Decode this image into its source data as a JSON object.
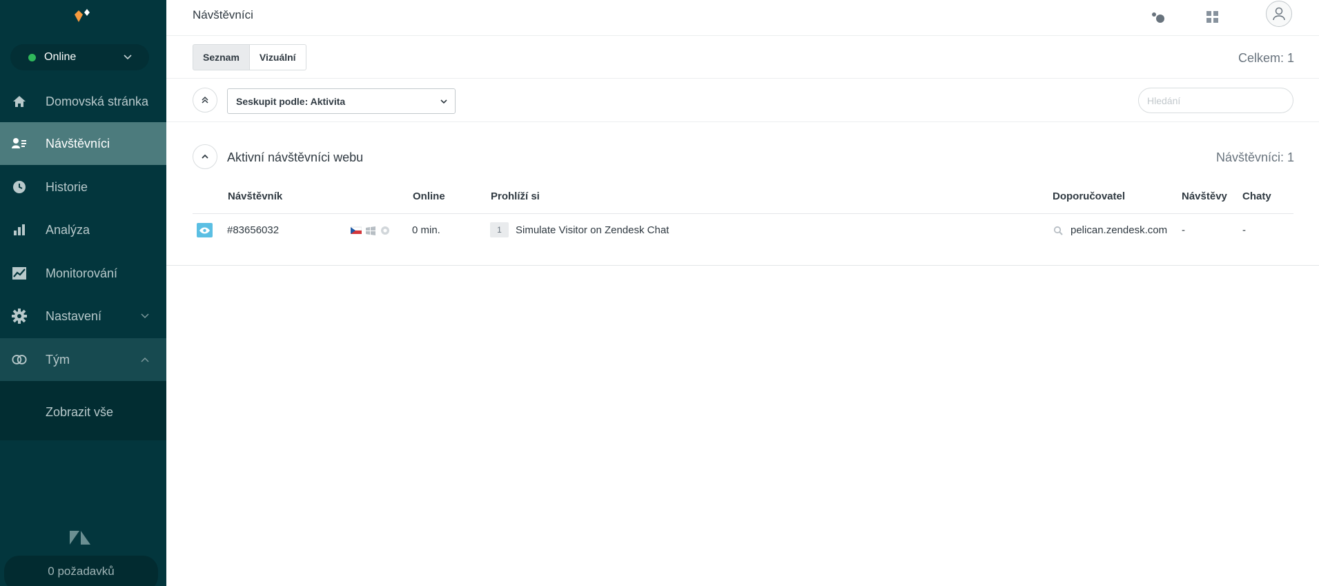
{
  "sidebar": {
    "status": {
      "label": "Online",
      "color": "#2fb85b"
    },
    "items": [
      {
        "label": "Domovská stránka",
        "icon": "home-icon"
      },
      {
        "label": "Návštěvníci",
        "icon": "visitors-icon"
      },
      {
        "label": "Historie",
        "icon": "clock-icon"
      },
      {
        "label": "Analýza",
        "icon": "bar-chart-icon"
      },
      {
        "label": "Monitorování",
        "icon": "monitor-chart-icon"
      },
      {
        "label": "Nastavení",
        "icon": "gear-icon"
      },
      {
        "label": "Tým",
        "icon": "team-icon"
      }
    ],
    "team_sub": {
      "label": "Zobrazit vše"
    },
    "requests": "0 požadavků"
  },
  "topbar": {
    "title": "Návštěvníci"
  },
  "toolbar": {
    "list_label": "Seznam",
    "visual_label": "Vizuální",
    "total": "Celkem: 1"
  },
  "filter": {
    "groupby": "Seskupit podle: Aktivita",
    "search_placeholder": "Hledání"
  },
  "section": {
    "title": "Aktivní návštěvníci webu",
    "count": "Návštěvníci: 1"
  },
  "table": {
    "headers": {
      "visitor": "Návštěvník",
      "online": "Online",
      "viewing": "Prohlíží si",
      "referrer": "Doporučovatel",
      "visits": "Návštěvy",
      "chats": "Chaty"
    },
    "rows": [
      {
        "id": "#83656032",
        "online": "0 min.",
        "pages": "1",
        "viewing": "Simulate Visitor on Zendesk Chat",
        "referrer": "pelican.zendesk.com",
        "visits": "-",
        "chats": "-"
      }
    ]
  },
  "colors": {
    "sidebar_bg": "#03363d",
    "active_bg": "#4c7b7d",
    "accent": "#f79a3e",
    "eye": "#5bbfe3"
  }
}
